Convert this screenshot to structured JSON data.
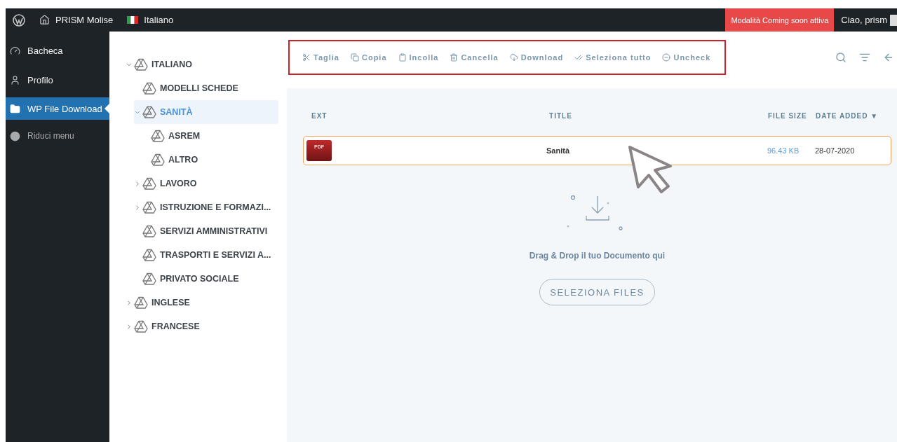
{
  "admin_bar": {
    "site": "PRISM Molise",
    "language": "Italiano",
    "notice": "Modalità Coming soon attiva",
    "greeting": "Ciao, prism"
  },
  "sidebar": {
    "items": [
      {
        "label": "Bacheca",
        "selected": false,
        "muted": false
      },
      {
        "label": "Profilo",
        "selected": false,
        "muted": false
      },
      {
        "label": "WP File Download",
        "selected": true,
        "muted": false
      },
      {
        "label": "Riduci menu",
        "selected": false,
        "muted": true
      }
    ]
  },
  "tree": [
    {
      "label": "ITALIANO",
      "expandable": true,
      "expanded": true,
      "selected": false,
      "children": [
        {
          "label": "MODELLI SCHEDE",
          "expandable": false,
          "expanded": false,
          "selected": false
        },
        {
          "label": "SANITÀ",
          "expandable": true,
          "expanded": true,
          "selected": true,
          "children": [
            {
              "label": "ASREM",
              "expandable": false,
              "expanded": false,
              "selected": false
            },
            {
              "label": "ALTRO",
              "expandable": false,
              "expanded": false,
              "selected": false
            }
          ]
        },
        {
          "label": "LAVORO",
          "expandable": true,
          "expanded": false,
          "selected": false
        },
        {
          "label": "ISTRUZIONE E FORMAZI...",
          "expandable": true,
          "expanded": false,
          "selected": false
        },
        {
          "label": "SERVIZI AMMINISTRATIVI",
          "expandable": false,
          "expanded": false,
          "selected": false
        },
        {
          "label": "TRASPORTI E SERVIZI A...",
          "expandable": false,
          "expanded": false,
          "selected": false
        },
        {
          "label": "PRIVATO SOCIALE",
          "expandable": false,
          "expanded": false,
          "selected": false
        }
      ]
    },
    {
      "label": "INGLESE",
      "expandable": true,
      "expanded": false,
      "selected": false
    },
    {
      "label": "FRANCESE",
      "expandable": true,
      "expanded": false,
      "selected": false
    }
  ],
  "toolbar": {
    "actions": [
      {
        "label": "Taglia"
      },
      {
        "label": "Copia"
      },
      {
        "label": "Incolla"
      },
      {
        "label": "Cancella"
      },
      {
        "label": "Download"
      },
      {
        "label": "Seleziona tutto"
      },
      {
        "label": "Uncheck"
      }
    ]
  },
  "table": {
    "columns": [
      {
        "label": "EXT"
      },
      {
        "label": "TITLE"
      },
      {
        "label": "FILE SIZE"
      },
      {
        "label": "DATE ADDED"
      }
    ],
    "sort_indicator": "▼",
    "rows": [
      {
        "ext": "PDF",
        "title": "Sanità",
        "size": "96.43 KB",
        "date": "28-07-2020",
        "selected": true
      }
    ]
  },
  "dropzone": {
    "text": "Drag & Drop il tuo Documento qui",
    "button": "SELEZIONA FILES"
  }
}
